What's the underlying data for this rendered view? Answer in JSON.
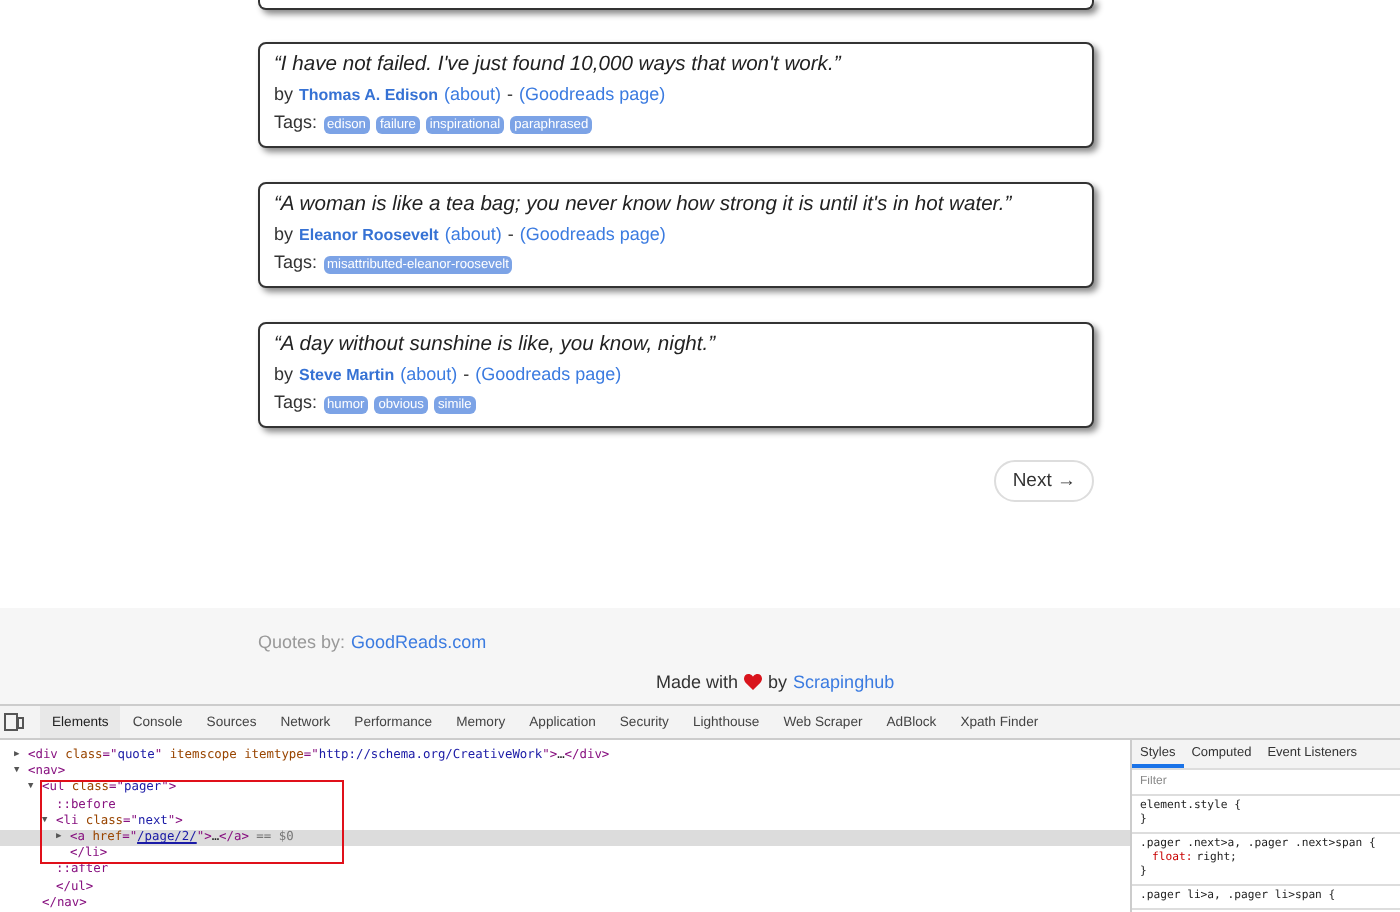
{
  "quotes": [
    {
      "cut": true
    },
    {
      "text": "“I have not failed. I've just found 10,000 ways that won't work.”",
      "by": "by",
      "author": "Thomas A. Edison",
      "about": "(about)",
      "sep": "-",
      "goodreads": "(Goodreads page)",
      "tags_label": "Tags:",
      "tags": [
        "edison",
        "failure",
        "inspirational",
        "paraphrased"
      ]
    },
    {
      "text": "“A woman is like a tea bag; you never know how strong it is until it's in hot water.”",
      "by": "by",
      "author": "Eleanor Roosevelt",
      "about": "(about)",
      "sep": "-",
      "goodreads": "(Goodreads page)",
      "tags_label": "Tags:",
      "tags": [
        "misattributed-eleanor-roosevelt"
      ]
    },
    {
      "text": "“A day without sunshine is like, you know, night.”",
      "by": "by",
      "author": "Steve Martin",
      "about": "(about)",
      "sep": "-",
      "goodreads": "(Goodreads page)",
      "tags_label": "Tags:",
      "tags": [
        "humor",
        "obvious",
        "simile"
      ]
    }
  ],
  "pager": {
    "next": "Next →"
  },
  "footer": {
    "quotes_by": "Quotes by:",
    "source_link": "GoodReads.com",
    "made_with": "Made with",
    "by": "by",
    "maker_link": "Scrapinghub"
  },
  "devtools": {
    "tabs": [
      {
        "label": "Elements",
        "selected": true
      },
      {
        "label": "Console",
        "selected": false
      },
      {
        "label": "Sources",
        "selected": false
      },
      {
        "label": "Network",
        "selected": false
      },
      {
        "label": "Performance",
        "selected": false
      },
      {
        "label": "Memory",
        "selected": false
      },
      {
        "label": "Application",
        "selected": false
      },
      {
        "label": "Security",
        "selected": false
      },
      {
        "label": "Lighthouse",
        "selected": false
      },
      {
        "label": "Web Scraper",
        "selected": false
      },
      {
        "label": "AdBlock",
        "selected": false
      },
      {
        "label": "Xpath Finder",
        "selected": false
      }
    ],
    "annotation": {
      "kind": "box"
    },
    "tree": [
      {
        "toggle": "▶",
        "selected": false,
        "parts": [
          {
            "kind": "tag",
            "text": "<div "
          },
          {
            "kind": "attr",
            "text": "class"
          },
          {
            "kind": "tag",
            "text": "=\""
          },
          {
            "kind": "value",
            "text": "quote"
          },
          {
            "kind": "tag",
            "text": "\" "
          },
          {
            "kind": "attr",
            "text": "itemscope itemtype"
          },
          {
            "kind": "tag",
            "text": "=\""
          },
          {
            "kind": "value",
            "text": "http://schema.org/CreativeWork"
          },
          {
            "kind": "tag",
            "text": "\">"
          },
          {
            "kind": "plain",
            "text": "…"
          },
          {
            "kind": "tag",
            "text": "</div>"
          }
        ]
      },
      {
        "toggle": "▼",
        "selected": false,
        "parts": [
          {
            "kind": "tag",
            "text": "<nav>"
          }
        ],
        "children": [
          {
            "toggle": "▼",
            "selected": false,
            "parts": [
              {
                "kind": "tag",
                "text": "<ul "
              },
              {
                "kind": "attr",
                "text": "class"
              },
              {
                "kind": "tag",
                "text": "=\""
              },
              {
                "kind": "value",
                "text": "pager"
              },
              {
                "kind": "tag",
                "text": "\">"
              }
            ],
            "children": [
              {
                "selected": false,
                "parts": [
                  {
                    "kind": "pseudo",
                    "text": "::before"
                  }
                ]
              },
              {
                "toggle": "▼",
                "selected": false,
                "parts": [
                  {
                    "kind": "tag",
                    "text": "<li "
                  },
                  {
                    "kind": "attr",
                    "text": "class"
                  },
                  {
                    "kind": "tag",
                    "text": "=\""
                  },
                  {
                    "kind": "value",
                    "text": "next"
                  },
                  {
                    "kind": "tag",
                    "text": "\">"
                  }
                ],
                "children": [
                  {
                    "toggle": "▶",
                    "selected": true,
                    "parts": [
                      {
                        "kind": "tag",
                        "text": "<a "
                      },
                      {
                        "kind": "attr",
                        "text": "href"
                      },
                      {
                        "kind": "tag",
                        "text": "=\""
                      },
                      {
                        "kind": "link",
                        "text": "/page/2/"
                      },
                      {
                        "kind": "tag",
                        "text": "\">"
                      },
                      {
                        "kind": "plain",
                        "text": "…"
                      },
                      {
                        "kind": "tag",
                        "text": "</a>"
                      },
                      {
                        "kind": "hint",
                        "text": " == $0"
                      }
                    ]
                  },
                  {
                    "selected": false,
                    "parts": [
                      {
                        "kind": "tag",
                        "text": "</li>"
                      }
                    ]
                  }
                ]
              },
              {
                "selected": false,
                "parts": [
                  {
                    "kind": "pseudo",
                    "text": "::after"
                  }
                ]
              },
              {
                "selected": false,
                "parts": [
                  {
                    "kind": "tag",
                    "text": "</ul>"
                  }
                ]
              }
            ]
          },
          {
            "selected": false,
            "parts": [
              {
                "kind": "tag",
                "text": "</nav>"
              }
            ]
          }
        ]
      }
    ],
    "styles": {
      "tabs": [
        {
          "label": "Styles",
          "selected": true
        },
        {
          "label": "Computed",
          "selected": false
        },
        {
          "label": "Event Listeners",
          "selected": false
        }
      ],
      "filter": {
        "placeholder": "Filter"
      },
      "rules": [
        {
          "selector": "element.style {",
          "close": "}"
        },
        {
          "selector": ".pager .next>a, .pager .next>span {",
          "properties": [
            {
              "name": "float:",
              "value": "right;"
            }
          ],
          "close": "}"
        },
        {
          "selector": ".pager li>a, .pager li>span {"
        }
      ]
    }
  }
}
